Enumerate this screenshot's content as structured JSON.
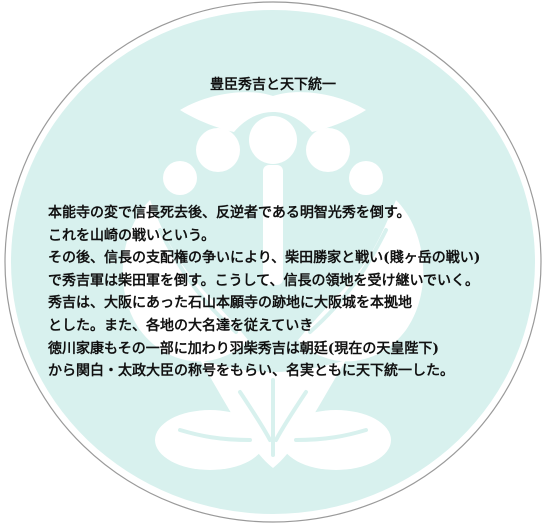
{
  "slide": {
    "title": "豊臣秀吉と天下統一",
    "lines": [
      "本能寺の変で信長死去後、反逆者である明智光秀を倒す。",
      "これを山崎の戦いという。",
      "その後、信長の支配権の争いにより、柴田勝家と戦い(賤ヶ岳の戦い)",
      "で秀吉軍は柴田軍を倒す。こうして、信長の領地を受け継いでいく。",
      "秀吉は、大阪にあった石山本願寺の跡地に大阪城を本拠地",
      "とした。また、各地の大名達を従えていき",
      "徳川家康もその一部に加わり羽柴秀吉は朝廷(現在の天皇陛下)",
      "から関白・太政大臣の称号をもらい、名実ともに天下統一した。"
    ]
  },
  "colors": {
    "background": "#ffffff",
    "crest_fill": "#d8f1ee",
    "ring_stroke": "#9a9a9a",
    "text": "#111111"
  },
  "icons": {
    "background_emblem": "paulownia-crest-icon"
  }
}
